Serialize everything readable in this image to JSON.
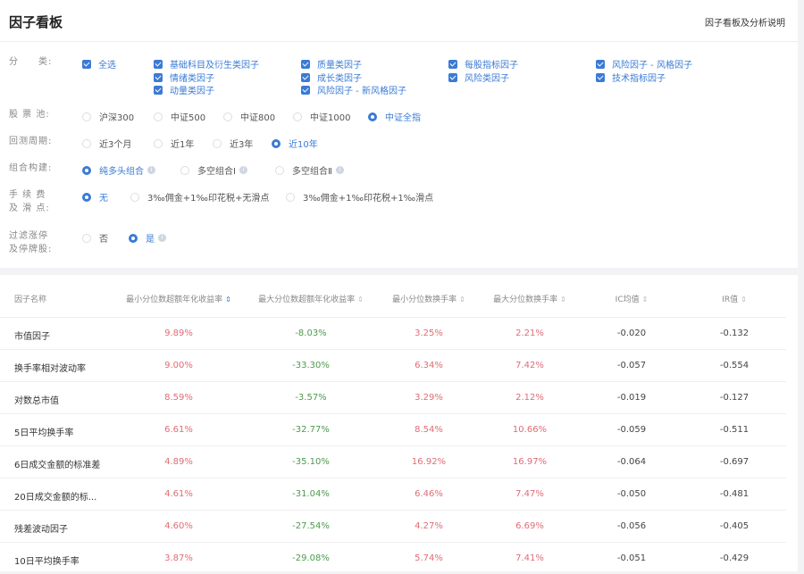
{
  "header": {
    "title": "因子看板",
    "help_link": "因子看板及分析说明"
  },
  "filters": {
    "category": {
      "label": "分　　类:",
      "options": [
        {
          "label": "全选",
          "checked": true
        },
        {
          "label": "基础科目及衍生类因子",
          "checked": true
        },
        {
          "label": "质量类因子",
          "checked": true
        },
        {
          "label": "每股指标因子",
          "checked": true
        },
        {
          "label": "风险因子 - 风格因子",
          "checked": true
        },
        {
          "label": "情绪类因子",
          "checked": true
        },
        {
          "label": "成长类因子",
          "checked": true
        },
        {
          "label": "风险类因子",
          "checked": true
        },
        {
          "label": "技术指标因子",
          "checked": true
        },
        {
          "label": "动量类因子",
          "checked": true
        },
        {
          "label": "风险因子 - 新风格因子",
          "checked": true
        }
      ]
    },
    "pool": {
      "label": "股 票 池:",
      "options": [
        "沪深300",
        "中证500",
        "中证800",
        "中证1000",
        "中证全指"
      ],
      "selected": "中证全指"
    },
    "period": {
      "label": "回测周期:",
      "options": [
        "近3个月",
        "近1年",
        "近3年",
        "近10年"
      ],
      "selected": "近10年"
    },
    "portfolio": {
      "label": "组合构建:",
      "options": [
        "纯多头组合",
        "多空组合Ⅰ",
        "多空组合Ⅱ"
      ],
      "selected": "纯多头组合"
    },
    "fee": {
      "label1": "手 续 费",
      "label2": "及 滑 点:",
      "options": [
        "无",
        "3‰佣金+1‰印花税+无滑点",
        "3‰佣金+1‰印花税+1‰滑点"
      ],
      "selected": "无"
    },
    "limit": {
      "label1": "过滤涨停",
      "label2": "及停牌股:",
      "options": [
        "否",
        "是"
      ],
      "selected": "是"
    }
  },
  "colors": {
    "accent": "#3a7bd5",
    "positive": "#e06c75",
    "negative": "#4e9a4e"
  },
  "table": {
    "columns": [
      "因子名称",
      "最小分位数超额年化收益率",
      "最大分位数超额年化收益率",
      "最小分位数换手率",
      "最大分位数换手率",
      "IC均值",
      "IR值"
    ],
    "sorted_column": "最小分位数超额年化收益率",
    "rows": [
      [
        "市值因子",
        "9.89%",
        "-8.03%",
        "3.25%",
        "2.21%",
        "-0.020",
        "-0.132"
      ],
      [
        "换手率相对波动率",
        "9.00%",
        "-33.30%",
        "6.34%",
        "7.42%",
        "-0.057",
        "-0.554"
      ],
      [
        "对数总市值",
        "8.59%",
        "-3.57%",
        "3.29%",
        "2.12%",
        "-0.019",
        "-0.127"
      ],
      [
        "5日平均换手率",
        "6.61%",
        "-32.77%",
        "8.54%",
        "10.66%",
        "-0.059",
        "-0.511"
      ],
      [
        "6日成交金额的标准差",
        "4.89%",
        "-35.10%",
        "16.92%",
        "16.97%",
        "-0.064",
        "-0.697"
      ],
      [
        "20日成交金额的标...",
        "4.61%",
        "-31.04%",
        "6.46%",
        "7.47%",
        "-0.050",
        "-0.481"
      ],
      [
        "残差波动因子",
        "4.60%",
        "-27.54%",
        "4.27%",
        "6.69%",
        "-0.056",
        "-0.405"
      ],
      [
        "10日平均换手率",
        "3.87%",
        "-29.08%",
        "5.74%",
        "7.41%",
        "-0.051",
        "-0.429"
      ]
    ]
  }
}
